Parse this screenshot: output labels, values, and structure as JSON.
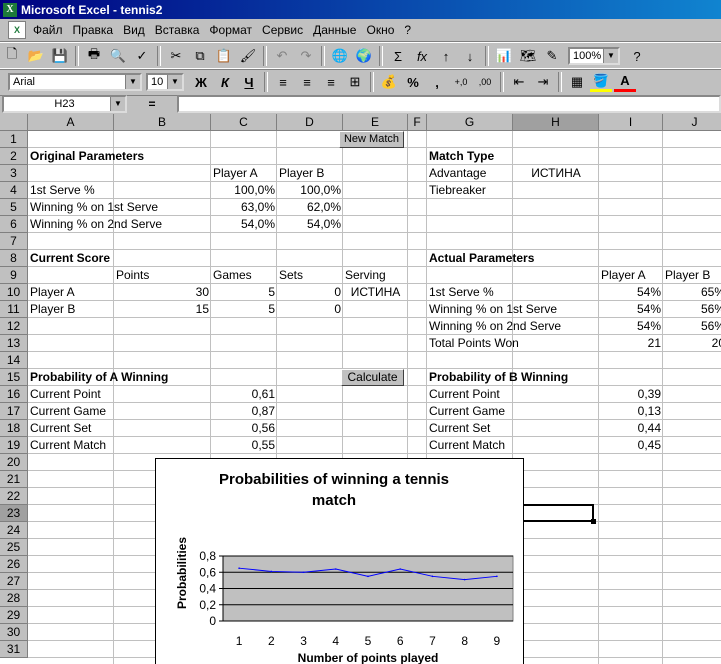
{
  "window": {
    "title": "Microsoft Excel - tennis2",
    "app_icon": "excel-icon"
  },
  "menu": [
    "Файл",
    "Правка",
    "Вид",
    "Вставка",
    "Формат",
    "Сервис",
    "Данные",
    "Окно",
    "?"
  ],
  "toolbar": {
    "zoom": "100%",
    "font": "Arial",
    "size": "10",
    "bold": "Ж",
    "italic": "К",
    "underline": "Ч",
    "percent": "%",
    "comma": ",",
    "inc_dec": "+,0",
    "dec_dec": ",00"
  },
  "formula_bar": {
    "name_box": "H23",
    "equals": "="
  },
  "columns": [
    "A",
    "B",
    "C",
    "D",
    "E",
    "F",
    "G",
    "H",
    "I",
    "J"
  ],
  "rows": [
    "1",
    "2",
    "3",
    "4",
    "5",
    "6",
    "7",
    "8",
    "9",
    "10",
    "11",
    "12",
    "13",
    "14",
    "15",
    "16",
    "17",
    "18",
    "19",
    "20",
    "21",
    "22",
    "23",
    "24",
    "25",
    "26",
    "27",
    "28",
    "29",
    "30",
    "31"
  ],
  "buttons": {
    "new_match": "New Match",
    "calculate": "Calculate"
  },
  "original": {
    "title": "Original Parameters",
    "player_a": "Player A",
    "player_b": "Player B",
    "rows": [
      {
        "label": "1st Serve %",
        "a": "100,0%",
        "b": "100,0%"
      },
      {
        "label": "Winning % on 1st Serve",
        "a": "63,0%",
        "b": "62,0%"
      },
      {
        "label": "Winning % on 2nd Serve",
        "a": "54,0%",
        "b": "54,0%"
      }
    ]
  },
  "match_type": {
    "title": "Match Type",
    "advantage": "Advantage",
    "advantage_val": "ИСТИНА",
    "tiebreaker": "Tiebreaker"
  },
  "score": {
    "title": "Current Score",
    "points": "Points",
    "games": "Games",
    "sets": "Sets",
    "serving": "Serving",
    "rows": [
      {
        "label": "Player A",
        "points": "30",
        "games": "5",
        "sets": "0",
        "serving": "ИСТИНА"
      },
      {
        "label": "Player B",
        "points": "15",
        "games": "5",
        "sets": "0",
        "serving": ""
      }
    ]
  },
  "actual": {
    "title": "Actual Parameters",
    "player_a": "Player A",
    "player_b": "Player B",
    "rows": [
      {
        "label": "1st Serve %",
        "a": "54%",
        "b": "65%"
      },
      {
        "label": "Winning % on 1st Serve",
        "a": "54%",
        "b": "56%"
      },
      {
        "label": "Winning % on 2nd Serve",
        "a": "54%",
        "b": "56%"
      },
      {
        "label": "Total Points Won",
        "a": "21",
        "b": "20"
      }
    ]
  },
  "prob_a": {
    "title": "Probability of A Winning",
    "rows": [
      {
        "label": "Current Point",
        "val": "0,61"
      },
      {
        "label": "Current Game",
        "val": "0,87"
      },
      {
        "label": "Current Set",
        "val": "0,56"
      },
      {
        "label": "Current Match",
        "val": "0,55"
      }
    ]
  },
  "prob_b": {
    "title": "Probability of B Winning",
    "rows": [
      {
        "label": "Current Point",
        "val": "0,39"
      },
      {
        "label": "Current Game",
        "val": "0,13"
      },
      {
        "label": "Current Set",
        "val": "0,44"
      },
      {
        "label": "Current Match",
        "val": "0,45"
      }
    ]
  },
  "chart_data": {
    "type": "line",
    "title": "Probabilities of winning a tennis match",
    "xlabel": "Number of points played",
    "ylabel": "Probabilities",
    "x": [
      1,
      2,
      3,
      4,
      5,
      6,
      7,
      8,
      9
    ],
    "series": [
      {
        "values": [
          0.65,
          0.61,
          0.6,
          0.64,
          0.55,
          0.64,
          0.55,
          0.51,
          0.55
        ]
      }
    ],
    "ylim": [
      0,
      0.8
    ],
    "yticks": [
      "0",
      "0,2",
      "0,4",
      "0,6",
      "0,8"
    ],
    "grid": true,
    "line_color": "#0000ff",
    "plot_bg": "#c0c0c0"
  }
}
